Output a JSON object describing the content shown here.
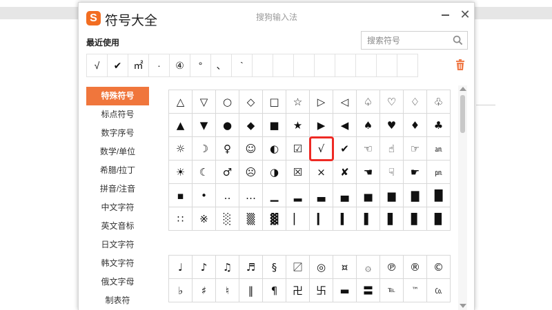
{
  "app": {
    "title": "符号大全",
    "subtitle": "搜狗输入法",
    "logo_letter": "S",
    "close_symbol": "✕"
  },
  "recent": {
    "label": "最近使用",
    "items": [
      "√",
      "✔",
      "㎡",
      "·",
      "④",
      "°",
      "、",
      "`",
      "",
      "",
      "",
      "",
      "",
      "",
      "",
      ""
    ]
  },
  "search": {
    "placeholder": "搜索符号"
  },
  "sidebar": {
    "items": [
      {
        "label": "特殊符号",
        "active": true
      },
      {
        "label": "标点符号"
      },
      {
        "label": "数字序号"
      },
      {
        "label": "数学/单位"
      },
      {
        "label": "希腊/拉丁"
      },
      {
        "label": "拼音/注音"
      },
      {
        "label": "中文字符"
      },
      {
        "label": "英文音标"
      },
      {
        "label": "日文字符"
      },
      {
        "label": "韩文字符"
      },
      {
        "label": "俄文字母"
      },
      {
        "label": "制表符"
      }
    ]
  },
  "symbols_grid1": [
    "△",
    "▽",
    "○",
    "◇",
    "□",
    "☆",
    "▷",
    "◁",
    "♤",
    "♡",
    "♢",
    "♧",
    "▲",
    "▼",
    "●",
    "◆",
    "■",
    "★",
    "▶",
    "◀",
    "♠",
    "♥",
    "♦",
    "♣",
    "☼",
    "☽",
    "♀",
    "☺",
    "◐",
    "☑",
    "√",
    "✔",
    "☜",
    "☝",
    "☞",
    "㏂",
    "☀",
    "☾",
    "♂",
    "☹",
    "◑",
    "☒",
    "×",
    "✘",
    "☚",
    "☟",
    "☛",
    "㏘",
    "▪",
    "•",
    "‥",
    "…",
    "▁",
    "▂",
    "▃",
    "▄",
    "▅",
    "▆",
    "▇",
    "█",
    "∷",
    "※",
    "░",
    "▒",
    "▓",
    "▏",
    "▎",
    "▍",
    "▌",
    "▋",
    "▊",
    "▉"
  ],
  "symbols_grid2": [
    "♩",
    "♪",
    "♫",
    "♬",
    "§",
    "〼",
    "◎",
    "¤",
    "۞",
    "℗",
    "®",
    "©",
    "♭",
    "♯",
    "♮",
    "‖",
    "¶",
    "卍",
    "卐",
    "▬",
    "〓",
    "℡",
    "™",
    "㏇"
  ],
  "highlighted_index": 30,
  "colors": {
    "accent": "#f0763c",
    "highlight": "#ee2a24",
    "logo": "#f26d21"
  }
}
